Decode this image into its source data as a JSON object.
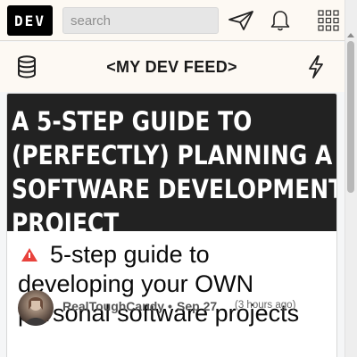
{
  "nav": {
    "logo": "DEV",
    "search_placeholder": "search",
    "icons": [
      "send-icon",
      "bell-icon",
      "apps-grid-icon"
    ]
  },
  "feed": {
    "title": "<MY DEV FEED>",
    "left_icon": "database-icon",
    "right_icon": "lightning-icon"
  },
  "article": {
    "cover_lines": [
      "A 5-STEP GUIDE TO",
      "(PERFECTLY) PLANNING A",
      "SOFTWARE DEVELOPMENT",
      "PROJECT"
    ],
    "title": "5-step guide to developing your OWN personal software projects",
    "author": "RealToughCandy",
    "separator": "•",
    "date": "Sep 27",
    "relative_time": "(3 hours ago)"
  },
  "colors": {
    "nav_bg": "#fdf9f3",
    "cover_bg": "#222222",
    "accent_red": "#e8423c"
  }
}
